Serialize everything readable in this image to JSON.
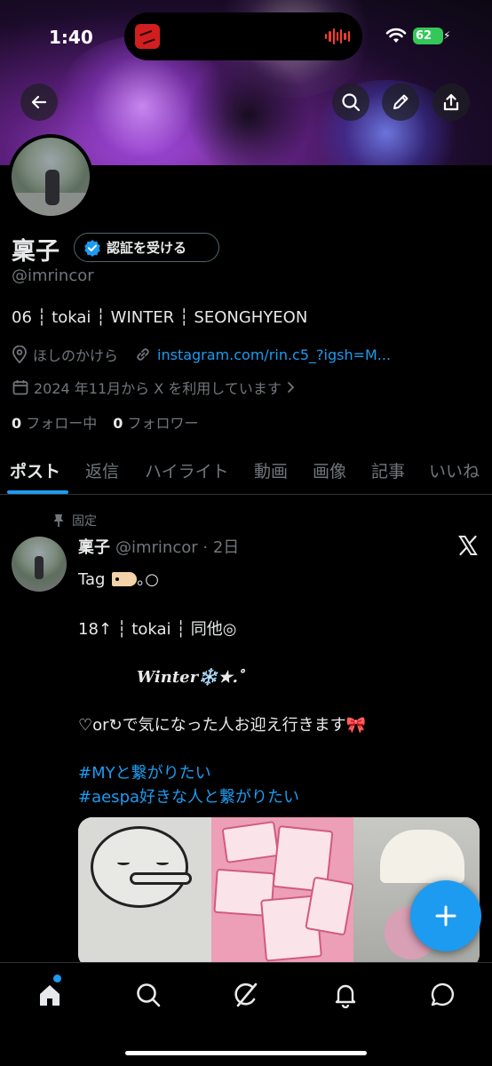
{
  "status_bar": {
    "time": "1:40",
    "battery": "62"
  },
  "profile": {
    "name": "稟子",
    "verify_label": "認証を受ける",
    "handle": "@imrincor",
    "bio": "06 ┆ tokai ┆ WINTER ┆ SEONGHYEON",
    "location": "ほしのかけら",
    "link": "instagram.com/rin.c5_?igsh=M...",
    "joined": "2024 年11月から X を利用しています",
    "following_count": "0",
    "following_label": "フォロー中",
    "followers_count": "0",
    "followers_label": "フォロワー"
  },
  "tabs": [
    {
      "label": "ポスト",
      "active": true
    },
    {
      "label": "返信",
      "active": false
    },
    {
      "label": "ハイライト",
      "active": false
    },
    {
      "label": "動画",
      "active": false
    },
    {
      "label": "画像",
      "active": false
    },
    {
      "label": "記事",
      "active": false
    },
    {
      "label": "いいね",
      "active": false
    }
  ],
  "post": {
    "pinned_label": "固定",
    "author_name": "稟子",
    "author_meta": "@imrincor · 2日",
    "line1": "Tag",
    "line1_suffix": "｡○",
    "line2": "18↑ ┆ tokai ┆ 同他◎",
    "line3": "Winter❄️★.゜",
    "line4": "♡or↻で気になった人お迎え行きます",
    "line4_emoji": "🎀",
    "hashtag1": "#MYと繋がりたい",
    "hashtag2": "#aespa好きな人と繋がりたい"
  },
  "colors": {
    "accent": "#1d9bf0",
    "text_primary": "#e7e9ea",
    "text_secondary": "#71767b",
    "background": "#000000",
    "battery": "#34c759"
  },
  "icons": {
    "header": [
      "back-arrow-icon",
      "search-icon",
      "pencil-icon",
      "share-icon"
    ],
    "nav": [
      "home-icon",
      "search-icon",
      "grok-icon",
      "bell-icon",
      "messages-icon"
    ]
  }
}
